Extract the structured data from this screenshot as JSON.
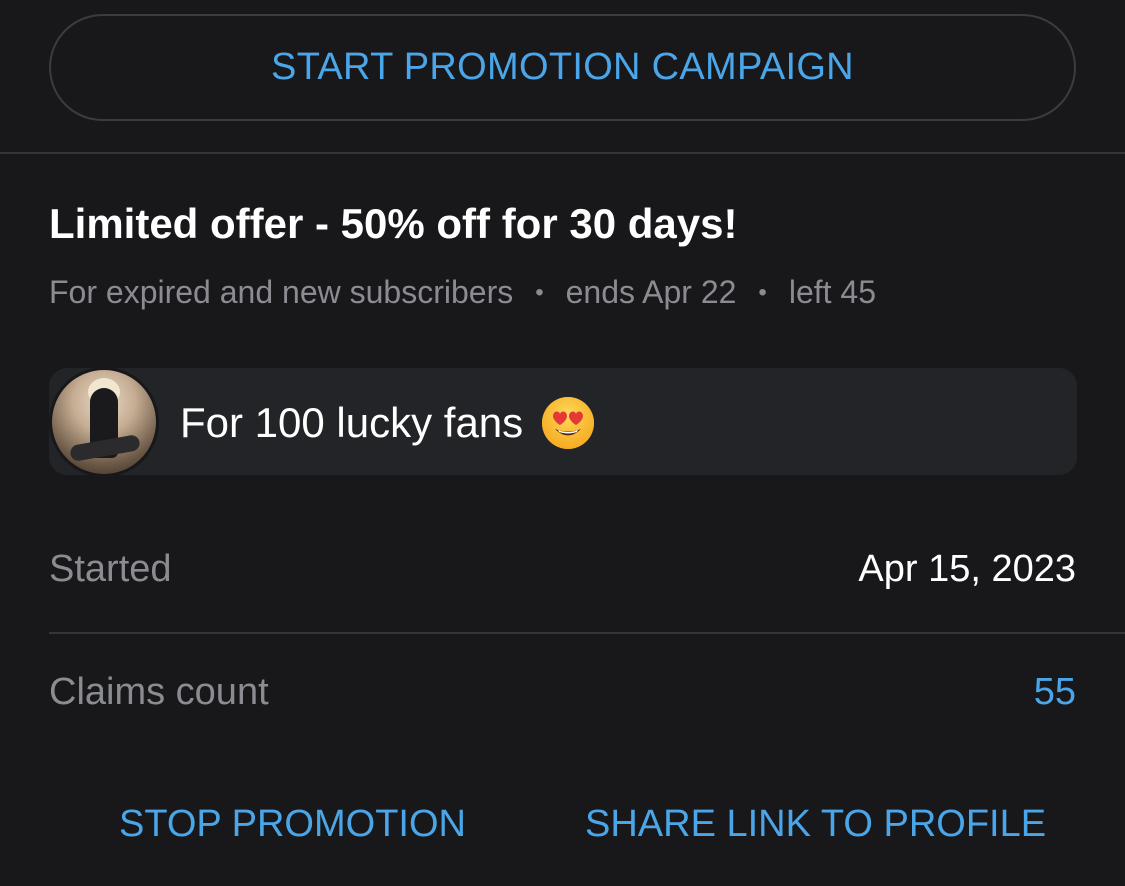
{
  "start_button_label": "START PROMOTION CAMPAIGN",
  "offer": {
    "title": "Limited offer - 50% off for 30 days!",
    "audience": "For expired and new subscribers",
    "ends": "ends Apr 22",
    "left": "left 45",
    "separator": "•"
  },
  "message": {
    "text": "For 100 lucky fans",
    "emoji": "heart-eyes-emoji"
  },
  "details": {
    "started_label": "Started",
    "started_value": "Apr 15, 2023",
    "claims_label": "Claims count",
    "claims_value": "55"
  },
  "actions": {
    "stop_label": "STOP PROMOTION",
    "share_label": "SHARE LINK TO PROFILE"
  },
  "colors": {
    "background": "#18181b",
    "accent": "#4aa6e8",
    "muted_text": "#8a8c92",
    "card": "#232427",
    "divider": "#34353a"
  }
}
